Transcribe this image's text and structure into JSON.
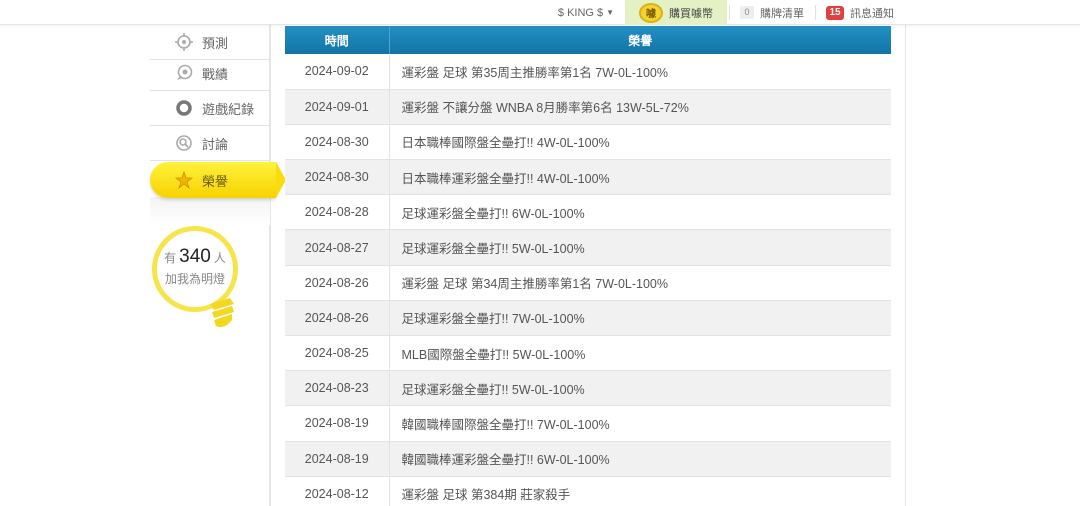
{
  "topbar": {
    "user_label": "$ KING $",
    "buy_coin_label": "購買噱幣",
    "coin_icon_text": "噱",
    "cart_count": "0",
    "cart_label": "購牌清單",
    "msg_count": "15",
    "msg_label": "訊息通知"
  },
  "sidebar": {
    "items": [
      {
        "label": "預測",
        "icon": "crosshair-icon"
      },
      {
        "label": "戰績",
        "icon": "chat-bubble-icon"
      },
      {
        "label": "遊戲紀錄",
        "icon": "ring-icon"
      },
      {
        "label": "討論",
        "icon": "magnifier-icon"
      },
      {
        "label": "榮譽",
        "icon": "star-icon"
      }
    ],
    "active_index": 4,
    "bulb": {
      "prefix": "有",
      "count": "340",
      "suffix": "人",
      "line2": "加我為明燈"
    }
  },
  "table": {
    "headers": [
      "時間",
      "榮譽"
    ],
    "rows": [
      {
        "date": "2024-09-02",
        "desc": "運彩盤 足球 第35周主推勝率第1名 7W-0L-100%"
      },
      {
        "date": "2024-09-01",
        "desc": "運彩盤 不讓分盤 WNBA 8月勝率第6名 13W-5L-72%"
      },
      {
        "date": "2024-08-30",
        "desc": "日本職棒國際盤全壘打!! 4W-0L-100%"
      },
      {
        "date": "2024-08-30",
        "desc": "日本職棒運彩盤全壘打!! 4W-0L-100%"
      },
      {
        "date": "2024-08-28",
        "desc": "足球運彩盤全壘打!! 6W-0L-100%"
      },
      {
        "date": "2024-08-27",
        "desc": "足球運彩盤全壘打!! 5W-0L-100%"
      },
      {
        "date": "2024-08-26",
        "desc": "運彩盤 足球 第34周主推勝率第1名 7W-0L-100%"
      },
      {
        "date": "2024-08-26",
        "desc": "足球運彩盤全壘打!! 7W-0L-100%"
      },
      {
        "date": "2024-08-25",
        "desc": "MLB國際盤全壘打!! 5W-0L-100%"
      },
      {
        "date": "2024-08-23",
        "desc": "足球運彩盤全壘打!! 5W-0L-100%"
      },
      {
        "date": "2024-08-19",
        "desc": "韓國職棒國際盤全壘打!! 7W-0L-100%"
      },
      {
        "date": "2024-08-19",
        "desc": "韓國職棒運彩盤全壘打!! 6W-0L-100%"
      },
      {
        "date": "2024-08-12",
        "desc": "運彩盤 足球 第384期 莊家殺手"
      }
    ]
  },
  "colors": {
    "header_blue": "#1a82b8",
    "active_yellow": "#f9dc10",
    "buy_bg": "#e3f1c5",
    "badge_red": "#e04040"
  }
}
